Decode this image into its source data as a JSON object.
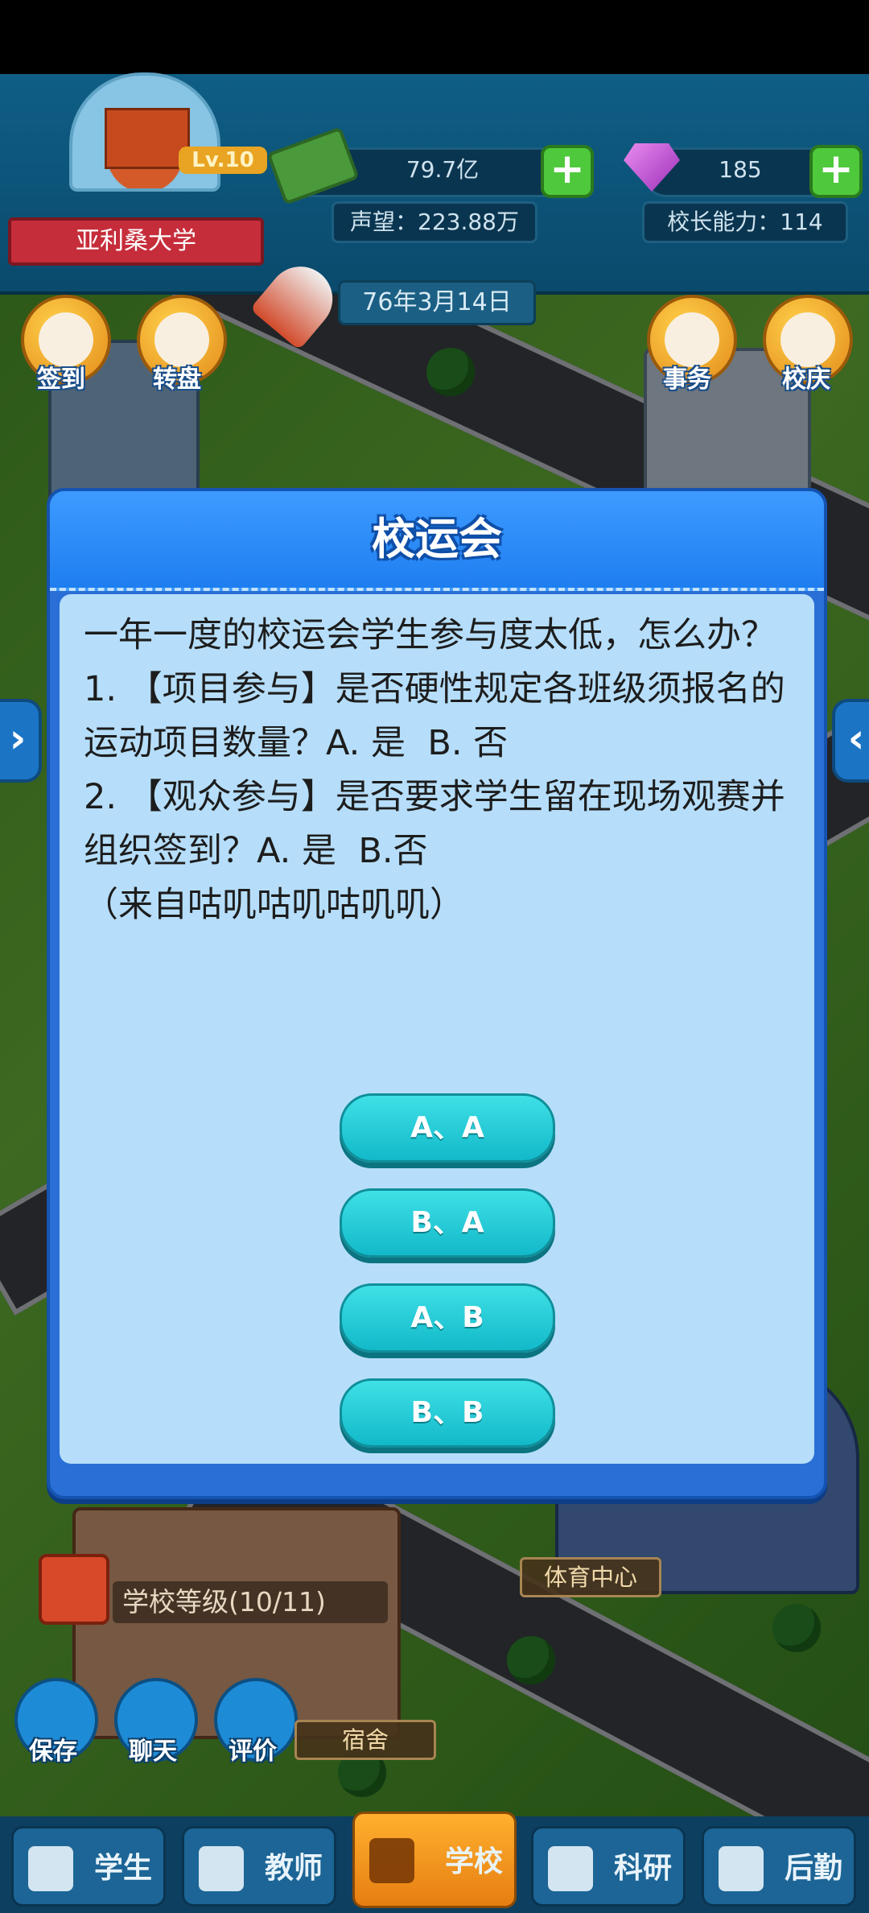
{
  "hud": {
    "school_name": "亚利桑大学",
    "level": "Lv.10",
    "money": "79.7亿",
    "gems": "185",
    "reputation": "声望：223.88万",
    "principal_ability": "校长能力：114",
    "date": "76年3月14日"
  },
  "side_buttons": {
    "sign_in": "签到",
    "wheel": "转盘",
    "affairs": "事务",
    "anniversary": "校庆"
  },
  "modal": {
    "title": "校运会",
    "question": "一年一度的校运会学生参与度太低，怎么办？\n1. 【项目参与】是否硬性规定各班级须报名的运动项目数量？A. 是  B. 否\n2. 【观众参与】是否要求学生留在现场观赛并组织签到？A. 是  B.否\n（来自咕叽咕叽咕叽叽）",
    "options": [
      "A、A",
      "B、A",
      "A、B",
      "B、B"
    ]
  },
  "bottom": {
    "school_level": "学校等级(10/11)",
    "save": "保存",
    "chat": "聊天",
    "review": "评价",
    "sports_center": "体育中心",
    "dorm": "宿舍"
  },
  "tabs": [
    "学生",
    "教师",
    "学校",
    "科研",
    "后勤"
  ]
}
